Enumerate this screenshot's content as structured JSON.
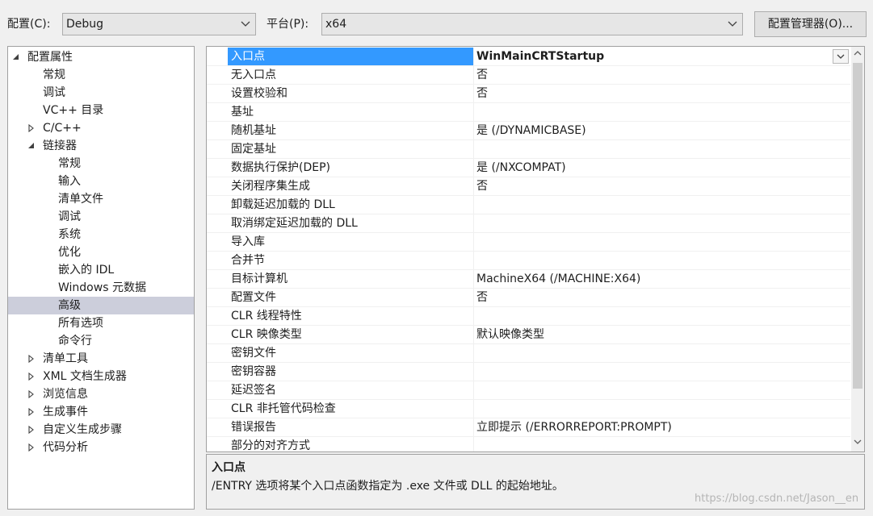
{
  "toolbar": {
    "config_label": "配置(C):",
    "config_value": "Debug",
    "platform_label": "平台(P):",
    "platform_value": "x64",
    "config_manager_button": "配置管理器(O)..."
  },
  "tree": [
    {
      "label": "配置属性",
      "level": 0,
      "toggle": "expanded"
    },
    {
      "label": "常规",
      "level": 1
    },
    {
      "label": "调试",
      "level": 1
    },
    {
      "label": "VC++ 目录",
      "level": 1
    },
    {
      "label": "C/C++",
      "level": 1,
      "toggle": "collapsed"
    },
    {
      "label": "链接器",
      "level": 1,
      "toggle": "expanded"
    },
    {
      "label": "常规",
      "level": 2
    },
    {
      "label": "输入",
      "level": 2
    },
    {
      "label": "清单文件",
      "level": 2
    },
    {
      "label": "调试",
      "level": 2
    },
    {
      "label": "系统",
      "level": 2
    },
    {
      "label": "优化",
      "level": 2
    },
    {
      "label": "嵌入的 IDL",
      "level": 2
    },
    {
      "label": "Windows 元数据",
      "level": 2
    },
    {
      "label": "高级",
      "level": 2,
      "selected": true
    },
    {
      "label": "所有选项",
      "level": 2
    },
    {
      "label": "命令行",
      "level": 2
    },
    {
      "label": "清单工具",
      "level": 1,
      "toggle": "collapsed"
    },
    {
      "label": "XML 文档生成器",
      "level": 1,
      "toggle": "collapsed"
    },
    {
      "label": "浏览信息",
      "level": 1,
      "toggle": "collapsed"
    },
    {
      "label": "生成事件",
      "level": 1,
      "toggle": "collapsed"
    },
    {
      "label": "自定义生成步骤",
      "level": 1,
      "toggle": "collapsed"
    },
    {
      "label": "代码分析",
      "level": 1,
      "toggle": "collapsed"
    }
  ],
  "properties": [
    {
      "name": "入口点",
      "value": "WinMainCRTStartup",
      "selected": true
    },
    {
      "name": "无入口点",
      "value": "否"
    },
    {
      "name": "设置校验和",
      "value": "否"
    },
    {
      "name": "基址",
      "value": ""
    },
    {
      "name": "随机基址",
      "value": "是 (/DYNAMICBASE)"
    },
    {
      "name": "固定基址",
      "value": ""
    },
    {
      "name": "数据执行保护(DEP)",
      "value": "是 (/NXCOMPAT)"
    },
    {
      "name": "关闭程序集生成",
      "value": "否"
    },
    {
      "name": "卸载延迟加载的 DLL",
      "value": ""
    },
    {
      "name": "取消绑定延迟加载的 DLL",
      "value": ""
    },
    {
      "name": "导入库",
      "value": ""
    },
    {
      "name": "合并节",
      "value": ""
    },
    {
      "name": "目标计算机",
      "value": "MachineX64 (/MACHINE:X64)"
    },
    {
      "name": "配置文件",
      "value": "否"
    },
    {
      "name": "CLR 线程特性",
      "value": ""
    },
    {
      "name": "CLR 映像类型",
      "value": "默认映像类型"
    },
    {
      "name": "密钥文件",
      "value": ""
    },
    {
      "name": "密钥容器",
      "value": ""
    },
    {
      "name": "延迟签名",
      "value": ""
    },
    {
      "name": "CLR 非托管代码检查",
      "value": ""
    },
    {
      "name": "错误报告",
      "value": "立即提示 (/ERRORREPORT:PROMPT)"
    },
    {
      "name": "部分的对齐方式",
      "value": ""
    }
  ],
  "description": {
    "title": "入口点",
    "text": "/ENTRY 选项将某个入口点函数指定为 .exe 文件或 DLL 的起始地址。"
  },
  "watermark": "https://blog.csdn.net/Jason__en",
  "colors": {
    "selection_blue": "#3399ff",
    "tree_selected": "#cccedb"
  }
}
